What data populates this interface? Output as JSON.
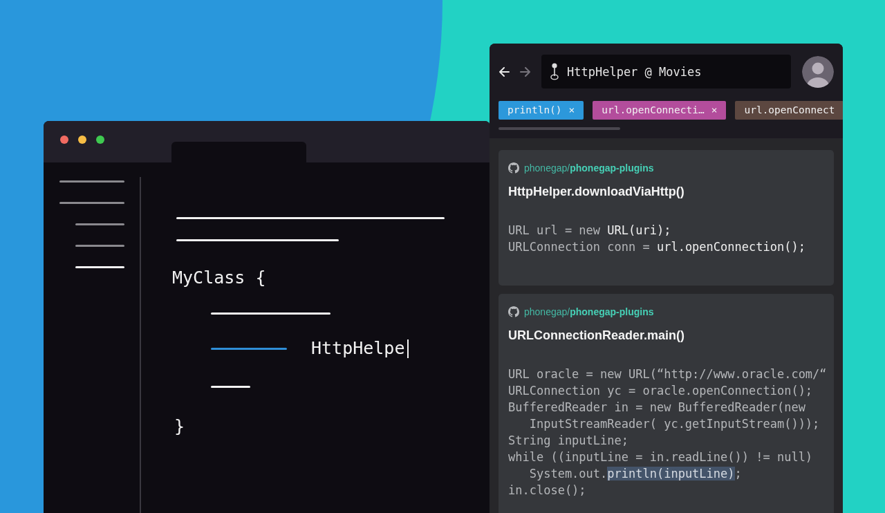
{
  "editor": {
    "sidebar": [
      {
        "selected": false
      },
      {
        "selected": false,
        "children": [
          {
            "selected": false
          },
          {
            "selected": false
          },
          {
            "selected": true
          }
        ]
      }
    ],
    "class_line": "MyClass {",
    "typed_text": "HttpHelpe",
    "closing_brace": "}"
  },
  "panel": {
    "nav": [
      {
        "kind": "back",
        "disabled": false
      },
      {
        "kind": "forward",
        "disabled": true
      }
    ],
    "search": {
      "value": "HttpHelper @ Movies"
    },
    "tabs": [
      {
        "label": "println()",
        "close": "×",
        "color": "#2c98db"
      },
      {
        "label": "url.openConnecti…",
        "close": "×",
        "color": "#b34d9c"
      },
      {
        "label": "url.openConnect",
        "color": "#5c4740"
      }
    ],
    "cards": [
      {
        "repo": "phonegap/**phonegap-plugins**",
        "title": "HttpHelper.downloadViaHttp()",
        "code": [
          {
            "segments": [
              {
                "text": "URL url = new ",
                "bright": false,
                "highlight": false
              },
              {
                "text": "URL(uri);",
                "bright": true,
                "highlight": false
              }
            ]
          },
          {
            "segments": [
              {
                "text": "URLConnection conn = ",
                "bright": false,
                "highlight": false
              },
              {
                "text": "url.openConnection();",
                "bright": true,
                "highlight": false
              }
            ]
          }
        ]
      },
      {
        "repo": "phonegap/**phonegap-plugins**",
        "title": "URLConnectionReader.main()",
        "code": [
          {
            "segments": [
              {
                "text": "URL oracle = new URL(“http://www.oracle.com/“",
                "bright": false,
                "highlight": false
              }
            ]
          },
          {
            "segments": [
              {
                "text": "URLConnection yc = oracle.openConnection();",
                "bright": false,
                "highlight": false
              }
            ]
          },
          {
            "segments": [
              {
                "text": "BufferedReader in = new BufferedReader(new",
                "bright": false,
                "highlight": false
              }
            ]
          },
          {
            "segments": [
              {
                "text": "   InputStreamReader( yc.getInputStream()));",
                "bright": false,
                "highlight": false
              }
            ]
          },
          {
            "segments": [
              {
                "text": "String inputLine;",
                "bright": false,
                "highlight": false
              }
            ]
          },
          {
            "segments": [
              {
                "text": "while ((inputLine = in.readLine()) != null)",
                "bright": false,
                "highlight": false
              }
            ]
          },
          {
            "segments": [
              {
                "text": "   System.out.",
                "bright": false,
                "highlight": false
              },
              {
                "text": "println(inputLine)",
                "bright": false,
                "highlight": true
              },
              {
                "text": ";",
                "bright": false,
                "highlight": false
              }
            ]
          },
          {
            "segments": [
              {
                "text": "in.close();",
                "bright": false,
                "highlight": false
              }
            ]
          }
        ]
      }
    ]
  }
}
